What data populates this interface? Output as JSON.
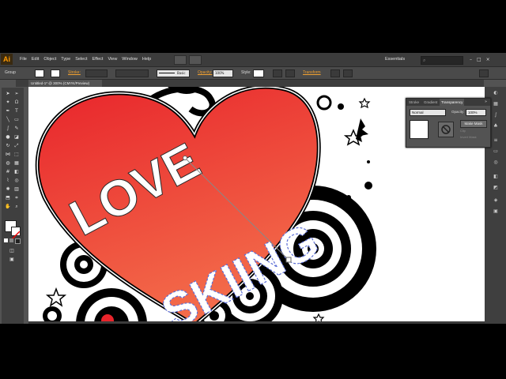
{
  "app": {
    "logo": "Ai",
    "menu": [
      "File",
      "Edit",
      "Object",
      "Type",
      "Select",
      "Effect",
      "View",
      "Window",
      "Help"
    ],
    "workspace": "Essentials",
    "window_controls": [
      "–",
      "□",
      "×"
    ]
  },
  "control_bar": {
    "selection_label": "Group",
    "stroke_label": "Stroke:",
    "brush_value": "Basic",
    "opacity_label": "Opacity:",
    "opacity_value": "100%",
    "style_label": "Style:",
    "transform_label": "Transform"
  },
  "document": {
    "tab_title": "Untitled-1* @ 300% (CMYK/Preview)"
  },
  "artwork": {
    "line1": "LOVE",
    "line2": "SKIING",
    "heart_color_top": "#e8242b",
    "heart_color_bottom": "#f36b4a"
  },
  "transparency_panel": {
    "tabs": [
      "Stroke",
      "Gradient",
      "Transparency"
    ],
    "blend_mode": "Normal",
    "opacity_label": "Opacity:",
    "opacity_value": "100%",
    "make_mask": "Make Mask",
    "clip_label": "Clip",
    "invert_label": "Invert Mask"
  },
  "colors": {
    "app_bg": "#535353",
    "menubar": "#3c3c3c",
    "accent": "#f0a030"
  }
}
